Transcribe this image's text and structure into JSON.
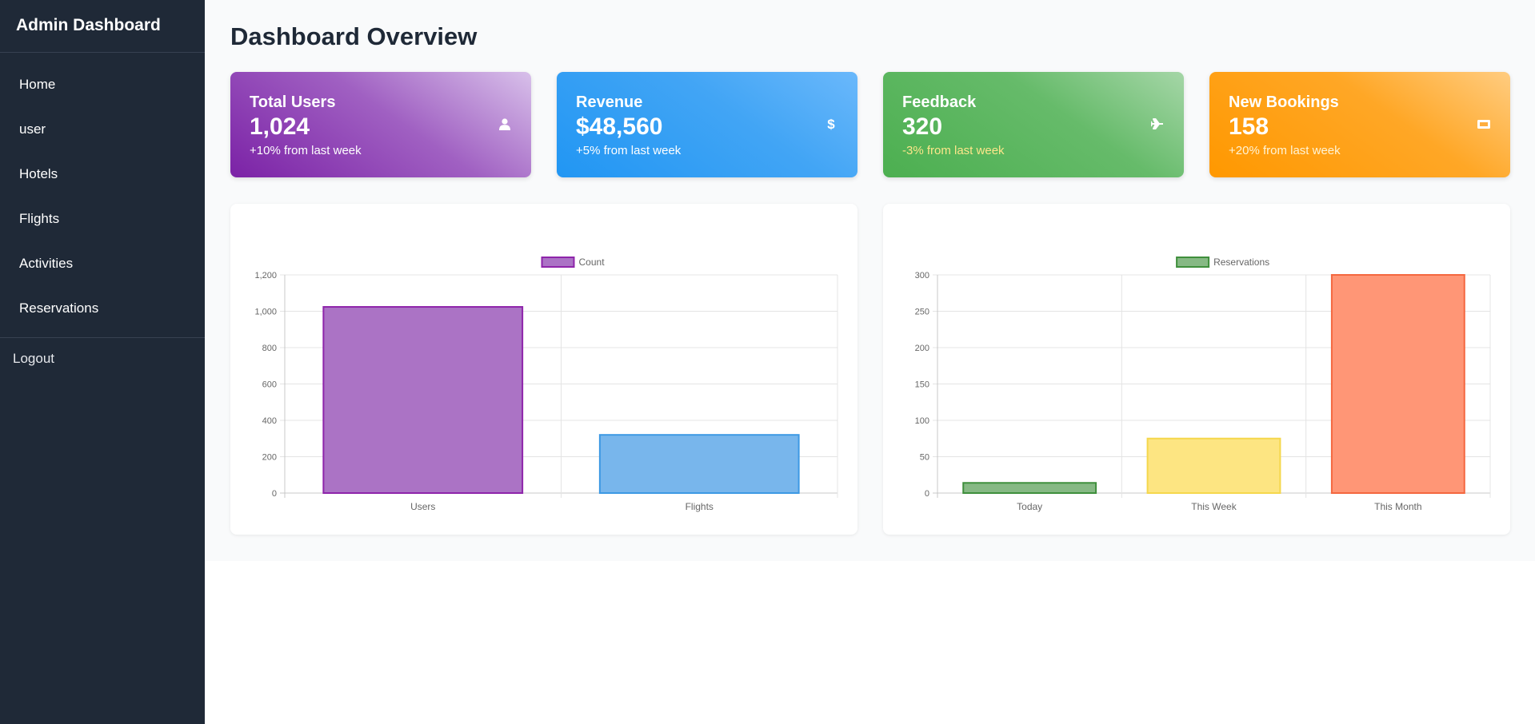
{
  "sidebar": {
    "title": "Admin Dashboard",
    "items": [
      {
        "label": "Home"
      },
      {
        "label": "user"
      },
      {
        "label": "Hotels"
      },
      {
        "label": "Flights"
      },
      {
        "label": "Activities"
      },
      {
        "label": "Reservations"
      }
    ],
    "logout": "Logout"
  },
  "main": {
    "title": "Dashboard Overview",
    "cards": [
      {
        "label": "Total Users",
        "value": "1,024",
        "change": "+10% from last week",
        "icon": "user-icon"
      },
      {
        "label": "Revenue",
        "value": "$48,560",
        "change": "+5% from last week",
        "icon": "dollar-icon"
      },
      {
        "label": "Feedback",
        "value": "320",
        "change": "-3% from last week",
        "icon": "plane-icon"
      },
      {
        "label": "New Bookings",
        "value": "158",
        "change": "+20% from last week",
        "icon": "ticket-icon"
      }
    ]
  },
  "chart_data": [
    {
      "type": "bar",
      "categories": [
        "Users",
        "Flights"
      ],
      "series": [
        {
          "name": "Count",
          "values": [
            1024,
            320
          ]
        }
      ],
      "bar_fill": [
        "#ab73c5",
        "#78b6ec"
      ],
      "bar_stroke": [
        "#8e24aa",
        "#3d99e4"
      ],
      "legend_fill": "#ab73c5",
      "legend_stroke": "#8e24aa",
      "yticks": [
        "0",
        "200",
        "400",
        "600",
        "800",
        "1,000",
        "1,200"
      ],
      "ylim": [
        0,
        1200
      ],
      "legend": "top-center",
      "grid": true
    },
    {
      "type": "bar",
      "categories": [
        "Today",
        "This Week",
        "This Month"
      ],
      "series": [
        {
          "name": "Reservations",
          "values": [
            14,
            75,
            300
          ]
        }
      ],
      "bar_fill": [
        "#86b984",
        "#fde582",
        "#ff9676"
      ],
      "bar_stroke": [
        "#3f8f3c",
        "#f5d74c",
        "#f4673f"
      ],
      "legend_fill": "#86b984",
      "legend_stroke": "#3f8f3c",
      "yticks": [
        "0",
        "50",
        "100",
        "150",
        "200",
        "250",
        "300"
      ],
      "ylim": [
        0,
        300
      ],
      "legend": "top-center",
      "grid": true
    }
  ]
}
